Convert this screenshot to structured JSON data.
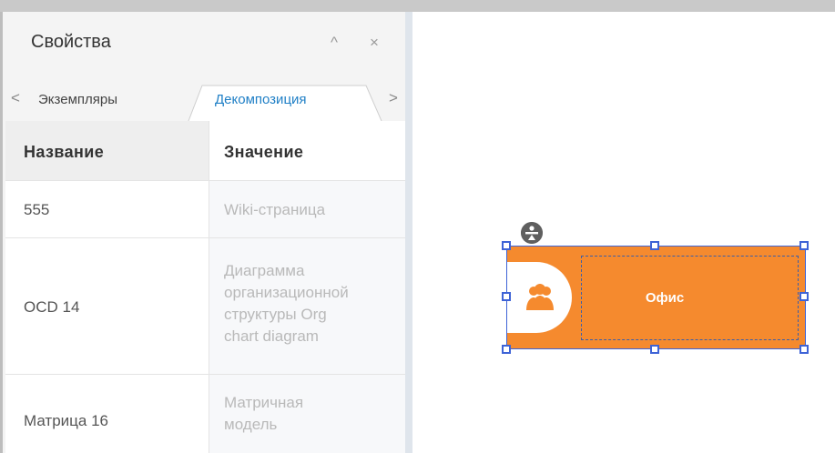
{
  "panel": {
    "title": "Свойства",
    "collapse_icon": "^",
    "close_icon": "×"
  },
  "tabs": {
    "prev_icon": "<",
    "next_icon": ">",
    "items": [
      {
        "label": "Экземпляры",
        "active": false
      },
      {
        "label": "Декомпозиция",
        "active": true
      }
    ]
  },
  "table": {
    "columns": [
      "Название",
      "Значение"
    ],
    "rows": [
      {
        "name": "555",
        "value": "Wiki-страница"
      },
      {
        "name": "OCD 14",
        "value": "Диаграмма\nорганизационной\nструктуры Org\nchart diagram"
      },
      {
        "name": "Матрица 16",
        "value": "Матричная\nмодель"
      }
    ]
  },
  "canvas": {
    "shape_label": "Офис",
    "shape_icon": "people-group-icon",
    "rotate_icon": "rotate-handle-icon"
  },
  "colors": {
    "accent": "#1f7fc6",
    "shape_fill": "#f58a2e",
    "selection": "#3e63d6"
  }
}
